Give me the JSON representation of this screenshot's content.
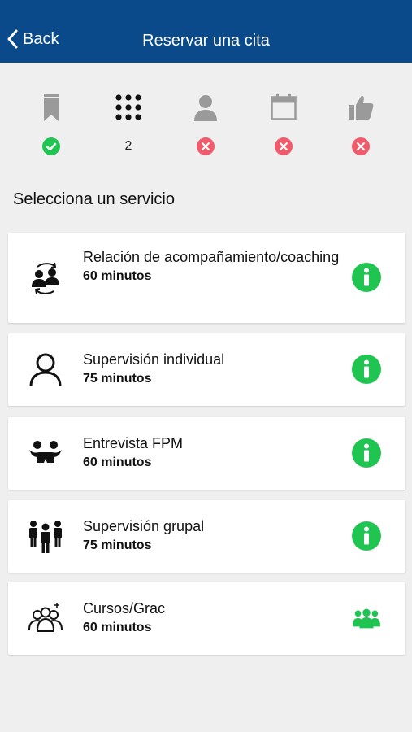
{
  "header": {
    "back_label": "Back",
    "title": "Reservar una cita"
  },
  "colors": {
    "header_bg": "#0a4a8a",
    "accent_green": "#1fc451",
    "error_red": "#f05a6a",
    "step_gray": "#9a9a9a"
  },
  "steps": [
    {
      "icon": "bookmark-icon",
      "status": "done",
      "status_icon": "check-circle-icon"
    },
    {
      "icon": "grid-icon",
      "status": "current",
      "status_text": "2"
    },
    {
      "icon": "person-icon",
      "status": "pending",
      "status_icon": "x-circle-icon"
    },
    {
      "icon": "calendar-icon",
      "status": "pending",
      "status_icon": "x-circle-icon"
    },
    {
      "icon": "thumbs-up-icon",
      "status": "pending",
      "status_icon": "x-circle-icon"
    }
  ],
  "section_title": "Selecciona un servicio",
  "services": [
    {
      "name": "Relación de acompañamiento/coaching",
      "duration": "60 minutos",
      "icon": "coaching-exchange-icon",
      "action_icon": "info-icon"
    },
    {
      "name": "Supervisión individual",
      "duration": "75 minutos",
      "icon": "person-outline-icon",
      "action_icon": "info-icon"
    },
    {
      "name": "Entrevista FPM",
      "duration": "60 minutos",
      "icon": "handshake-icon",
      "action_icon": "info-icon"
    },
    {
      "name": "Supervisión grupal",
      "duration": "75 minutos",
      "icon": "group-people-icon",
      "action_icon": "info-icon"
    },
    {
      "name": "Cursos/Grac",
      "duration": "60 minutos",
      "icon": "group-outline-icon",
      "action_icon": "group-icon"
    }
  ]
}
